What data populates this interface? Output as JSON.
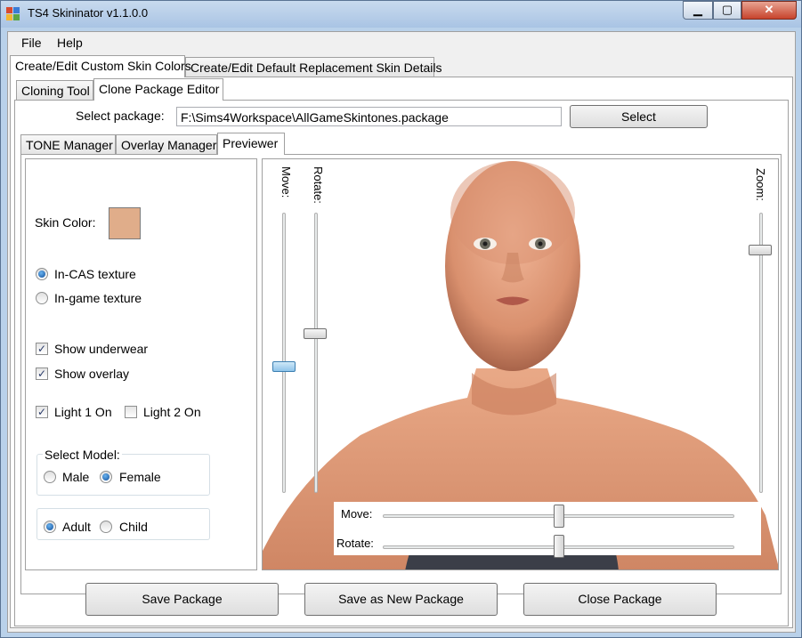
{
  "window": {
    "title": "TS4 Skininator v1.1.0.0",
    "minimize_glyph": "▁",
    "maximize_glyph": "▢",
    "close_glyph": "✕"
  },
  "menu": [
    "File",
    "Help"
  ],
  "main_tabs": [
    "Create/Edit Custom Skin Colors",
    "Create/Edit Default Replacement Skin Details"
  ],
  "sub_tabs": [
    "Cloning Tool",
    "Clone Package Editor"
  ],
  "package": {
    "label": "Select package:",
    "path": "F:\\Sims4Workspace\\AllGameSkintones.package",
    "select_button": "Select"
  },
  "editor_tabs": [
    "TONE Manager",
    "Overlay Manager",
    "Previewer"
  ],
  "settings": {
    "skin_color_label": "Skin Color:",
    "skin_color": "#e0ad8a",
    "texture_options": [
      {
        "label": "In-CAS texture",
        "selected": true
      },
      {
        "label": "In-game texture",
        "selected": false
      }
    ],
    "show_underwear": {
      "label": "Show underwear",
      "checked": true
    },
    "show_overlay": {
      "label": "Show overlay",
      "checked": true
    },
    "light1": {
      "label": "Light 1 On",
      "checked": true
    },
    "light2": {
      "label": "Light 2 On",
      "checked": false
    },
    "model_group_label": "Select Model:",
    "gender_options": [
      {
        "label": "Male",
        "selected": false
      },
      {
        "label": "Female",
        "selected": true
      }
    ],
    "age_options": [
      {
        "label": "Adult",
        "selected": true
      },
      {
        "label": "Child",
        "selected": false
      }
    ]
  },
  "preview": {
    "move_v_label": "Move:",
    "rotate_v_label": "Rotate:",
    "zoom_label": "Zoom:",
    "move_h_label": "Move:",
    "rotate_h_label": "Rotate:",
    "move_v_value": 0.55,
    "rotate_v_value": 0.43,
    "zoom_value": 0.88,
    "move_h_value": 0.5,
    "rotate_h_value": 0.5,
    "check_glyph": "✓"
  },
  "actions": {
    "save": "Save Package",
    "save_new": "Save as New Package",
    "close": "Close Package"
  }
}
